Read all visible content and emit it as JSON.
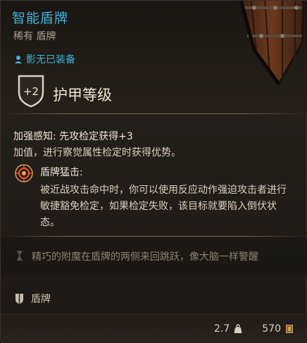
{
  "item": {
    "name": "智能盾牌",
    "rarity_type": "稀有 盾牌",
    "equipped_by": "影无已装备"
  },
  "armor": {
    "bonus": "+2",
    "label": "护甲等级"
  },
  "feature": {
    "name": "加强感知:",
    "name_suffix": " 先攻检定获得+3",
    "desc": "加值，进行察觉属性检定时获得优势。"
  },
  "ability": {
    "name": "盾牌猛击:",
    "desc": "被近战攻击命中时，你可以使用反应动作强迫攻击者进行敏捷豁免检定，如果检定失败，该目标就要陷入倒伏状态。"
  },
  "flavor": {
    "text": "精巧的附魔在盾牌的两侧来回跳跃，像大脑一样警醒"
  },
  "category": {
    "label": "盾牌"
  },
  "stats": {
    "weight": "2.7",
    "value": "570"
  },
  "colors": {
    "title": "#3fb2d8",
    "text": "#d9cfbf",
    "muted": "#8a8072",
    "accent_gold": "#c9a15a"
  }
}
